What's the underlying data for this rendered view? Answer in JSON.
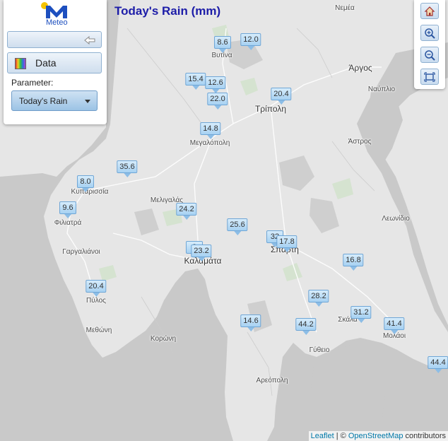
{
  "title": "Today's Rain (mm)",
  "panel": {
    "logo_text": "Meteo",
    "data_label": "Data",
    "parameter_label": "Parameter:",
    "parameter_value": "Today's Rain",
    "collapse_icon": "arrow-left-icon"
  },
  "controls": {
    "home_icon": "home-icon",
    "zoom_in_icon": "zoom-in-icon",
    "zoom_out_icon": "zoom-out-icon",
    "fullscreen_icon": "fullscreen-icon"
  },
  "attribution": {
    "leaflet": "Leaflet",
    "separator": " | © ",
    "osm": "OpenStreetMap",
    "contributors": " contributors"
  },
  "places": [
    {
      "name": "Νεμέα"
    },
    {
      "name": "Βυτίνα"
    },
    {
      "name": "Άργος"
    },
    {
      "name": "Ναύπλιο"
    },
    {
      "name": "Τρίπολη"
    },
    {
      "name": "Μεγαλόπολη"
    },
    {
      "name": "Άστρος"
    },
    {
      "name": "Κυπαρισσία"
    },
    {
      "name": "Μελιγαλάς"
    },
    {
      "name": "Φιλιατρά"
    },
    {
      "name": "Λεωνίδιο"
    },
    {
      "name": "Σπάρτη"
    },
    {
      "name": "Γαργαλιάνοι"
    },
    {
      "name": "Καλαμάτα"
    },
    {
      "name": "Πύλος"
    },
    {
      "name": "Μεθώνη"
    },
    {
      "name": "Κορώνη"
    },
    {
      "name": "Σκάλα"
    },
    {
      "name": "Μολάοι"
    },
    {
      "name": "Γύθειο"
    },
    {
      "name": "Αρεόπολη"
    }
  ],
  "stations": [
    {
      "value": "8.6"
    },
    {
      "value": "12.0"
    },
    {
      "value": "15.4"
    },
    {
      "value": "12.6"
    },
    {
      "value": "22.0"
    },
    {
      "value": "20.4"
    },
    {
      "value": "14.8"
    },
    {
      "value": "35.6"
    },
    {
      "value": "8.0"
    },
    {
      "value": "9.6"
    },
    {
      "value": "24.2"
    },
    {
      "value": "25.6"
    },
    {
      "value": "32"
    },
    {
      "value": "17.8"
    },
    {
      "value": "2"
    },
    {
      "value": "23.2"
    },
    {
      "value": "16.8"
    },
    {
      "value": "20.4"
    },
    {
      "value": "28.2"
    },
    {
      "value": "31.2"
    },
    {
      "value": "14.6"
    },
    {
      "value": "44.2"
    },
    {
      "value": "41.4"
    },
    {
      "value": "44.4"
    }
  ],
  "colors": {
    "land": "#e8e8e8",
    "sea": "#c8c8c8",
    "title": "#1d1da8",
    "marker": "#a6d1f2"
  }
}
